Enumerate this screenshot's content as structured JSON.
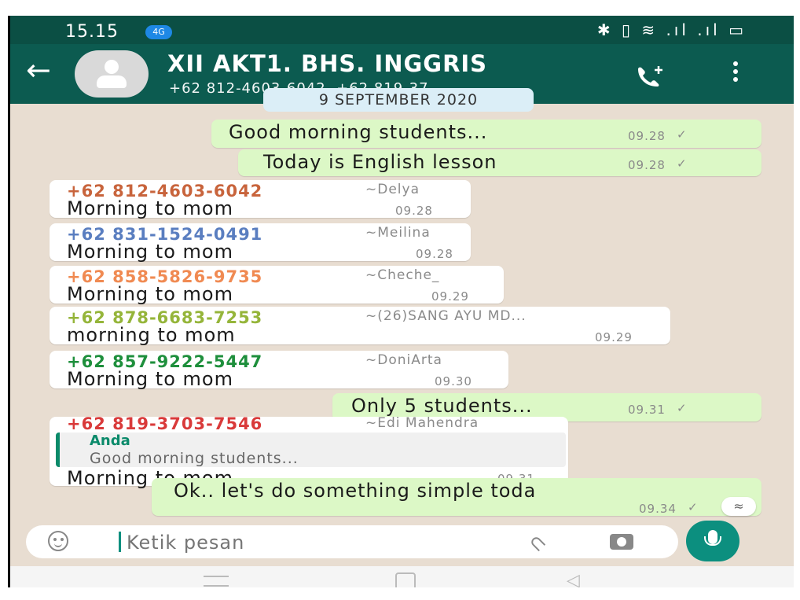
{
  "status": {
    "time": "15.15",
    "badge": "4G",
    "icons": "✱ ▯ ≋ .ıl .ıl ▭"
  },
  "header": {
    "title": "XII AKT1. BHS. INGGRIS",
    "participants": "+62 812-4603-6042, +62 819-37..."
  },
  "date_chip": "9 SEPTEMBER 2020",
  "messages": [
    {
      "text": "Good morning students...",
      "time": "09.28"
    },
    {
      "text": "Today is English lesson",
      "time": "09.28"
    },
    {
      "phone": "+62 812-4603-6042",
      "name": "~Delya",
      "text": "Morning to mom",
      "time": "09.28",
      "color": "#c8643c"
    },
    {
      "phone": "+62 831-1524-0491",
      "name": "~Meilina",
      "text": "Morning to mom",
      "time": "09.28",
      "color": "#5a7ec0"
    },
    {
      "phone": "+62 858-5826-9735",
      "name": "~Cheche_",
      "text": "Morning to mom",
      "time": "09.29",
      "color": "#f08a52"
    },
    {
      "phone": "+62 878-6683-7253",
      "name": "~(26)SANG AYU MD...",
      "text": "morning to mom",
      "time": "09.29",
      "color": "#95b53a"
    },
    {
      "phone": "+62 857-9222-5447",
      "name": "~DoniArta",
      "text": "Morning to mom",
      "time": "09.30",
      "color": "#1e8f3c"
    },
    {
      "text": "Only 5 students...",
      "time": "09.31"
    },
    {
      "phone": "+62 819-3703-7546",
      "name": "~Edi Mahendra",
      "text": "Morning to mom",
      "time": "09.31",
      "color": "#d93a3a",
      "quote": {
        "title": "Anda",
        "text": "Good morning students..."
      }
    },
    {
      "text": "Ok.. let's do something simple toda",
      "time": "09.34"
    }
  ],
  "composer": {
    "placeholder": "Ketik pesan"
  },
  "colors": {
    "header": "#0c5b50",
    "outgoing": "#dcf8c6",
    "accent": "#0c8f7f"
  }
}
